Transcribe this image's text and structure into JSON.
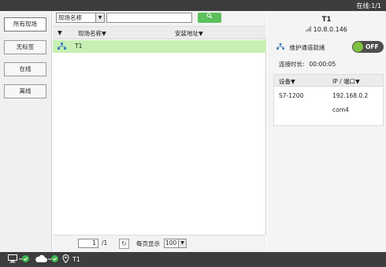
{
  "topbar": {
    "online_status": "在线:1/1"
  },
  "nav": {
    "items": [
      {
        "label": "所有现场"
      },
      {
        "label": "无标签"
      },
      {
        "label": "在线"
      },
      {
        "label": "离线"
      }
    ]
  },
  "search": {
    "filter_selected": "现场名称",
    "input_value": "",
    "button_icon": "search-icon"
  },
  "table": {
    "columns": [
      "▼",
      "现场名称▼",
      "安装地址▼"
    ],
    "rows": [
      {
        "icon": "network-icon",
        "name": "T1",
        "address": ""
      }
    ]
  },
  "pager": {
    "page": "1",
    "total": "/1",
    "per_page_label": "每页显示",
    "per_page_value": "100"
  },
  "detail": {
    "title": "T1",
    "ip": "10.8.0.146",
    "maintenance_label": "维护通道就绪",
    "toggle_label": "OFF",
    "connect_time_label": "连接时长:",
    "connect_time_value": "00:00:05",
    "device_columns": [
      "设备▼",
      "IP / 端口▼"
    ],
    "devices": [
      {
        "name": "S7-1200",
        "address": "192.168.0.2"
      },
      {
        "name": "",
        "address": "com4"
      }
    ]
  },
  "footer": {
    "site_name": "T1"
  },
  "colors": {
    "accent_green": "#5cc05c",
    "row_highlight": "#c8f0b4",
    "dark_bar": "#3d3d3d"
  }
}
